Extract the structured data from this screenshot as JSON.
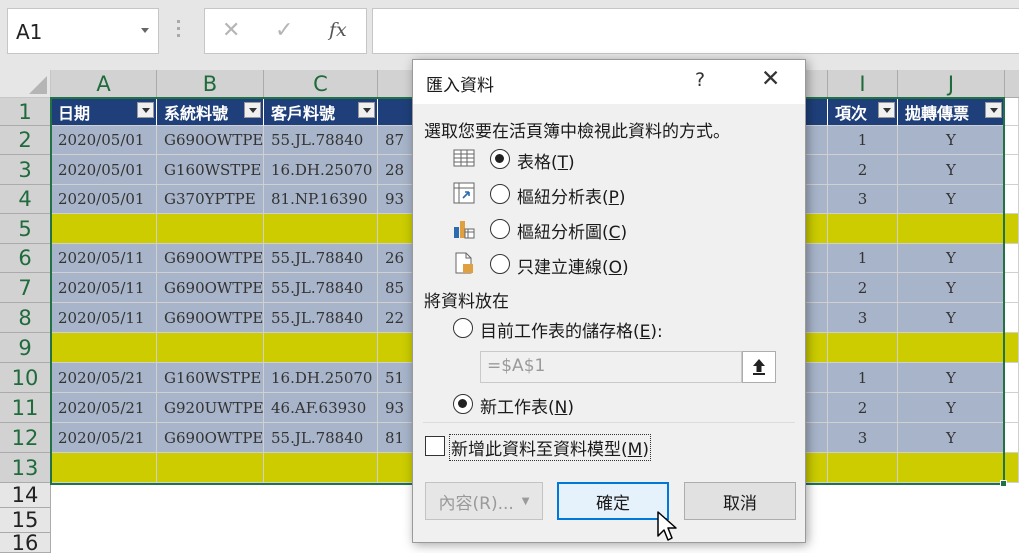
{
  "namebox": {
    "value": "A1"
  },
  "formula_bar": {
    "cancel_glyph": "✕",
    "enter_glyph": "✓",
    "fx_label": "fx",
    "value": ""
  },
  "columns": [
    "A",
    "B",
    "C",
    "I",
    "J"
  ],
  "rows": [
    "1",
    "2",
    "3",
    "4",
    "5",
    "6",
    "7",
    "8",
    "9",
    "10",
    "11",
    "12",
    "13",
    "14",
    "15",
    "16"
  ],
  "table": {
    "headers": [
      "日期",
      "系統料號",
      "客戶料號",
      "項次",
      "拋轉傳票"
    ],
    "rows": [
      {
        "a": "2020/05/01",
        "b": "G690OWTPE",
        "c": "55.JL.78840",
        "d": "87",
        "i": "1",
        "j": "Y"
      },
      {
        "a": "2020/05/01",
        "b": "G160WSTPE",
        "c": "16.DH.25070",
        "d": "28",
        "i": "2",
        "j": "Y"
      },
      {
        "a": "2020/05/01",
        "b": "G370YPTPE",
        "c": "81.NP.16390",
        "d": "93",
        "i": "3",
        "j": "Y"
      },
      {
        "a": "",
        "b": "",
        "c": "",
        "d": "",
        "i": "",
        "j": ""
      },
      {
        "a": "2020/05/11",
        "b": "G690OWTPE",
        "c": "55.JL.78840",
        "d": "26",
        "i": "1",
        "j": "Y"
      },
      {
        "a": "2020/05/11",
        "b": "G690OWTPE",
        "c": "55.JL.78840",
        "d": "85",
        "i": "2",
        "j": "Y"
      },
      {
        "a": "2020/05/11",
        "b": "G690OWTPE",
        "c": "55.JL.78840",
        "d": "22",
        "i": "3",
        "j": "Y"
      },
      {
        "a": "",
        "b": "",
        "c": "",
        "d": "",
        "i": "",
        "j": ""
      },
      {
        "a": "2020/05/21",
        "b": "G160WSTPE",
        "c": "16.DH.25070",
        "d": "51",
        "i": "1",
        "j": "Y"
      },
      {
        "a": "2020/05/21",
        "b": "G920UWTPE",
        "c": "46.AF.63930",
        "d": "93",
        "i": "2",
        "j": "Y"
      },
      {
        "a": "2020/05/21",
        "b": "G690OWTPE",
        "c": "55.JL.78840",
        "d": "81",
        "i": "3",
        "j": "Y"
      },
      {
        "a": "",
        "b": "",
        "c": "",
        "d": "",
        "i": "",
        "j": ""
      }
    ]
  },
  "colors": {
    "header_fill": "#1f3f7a",
    "data_fill": "#a7b4c9",
    "separator_fill": "#cccc00",
    "selection": "#217346"
  },
  "dialog": {
    "title": "匯入資料",
    "help": "?",
    "close": "✕",
    "prompt": "選取您要在活頁簿中檢視此資料的方式。",
    "view_options": [
      {
        "label": "表格",
        "key": "T",
        "selected": true,
        "icon": "table-icon"
      },
      {
        "label": "樞紐分析表",
        "key": "P",
        "selected": false,
        "icon": "pivot-table-icon"
      },
      {
        "label": "樞紐分析圖",
        "key": "C",
        "selected": false,
        "icon": "pivot-chart-icon"
      },
      {
        "label": "只建立連線",
        "key": "O",
        "selected": false,
        "icon": "connection-only-icon"
      }
    ],
    "placement_label": "將資料放在",
    "placement_options": [
      {
        "label": "目前工作表的儲存格",
        "key": "E",
        "suffix": ":",
        "selected": false
      },
      {
        "label": "新工作表",
        "key": "N",
        "suffix": "",
        "selected": true
      }
    ],
    "cell_ref": "=$A$1",
    "data_model": {
      "label": "新增此資料至資料模型",
      "key": "M",
      "checked": false
    },
    "buttons": {
      "properties": "內容(R)...",
      "ok": "確定",
      "cancel": "取消"
    }
  }
}
